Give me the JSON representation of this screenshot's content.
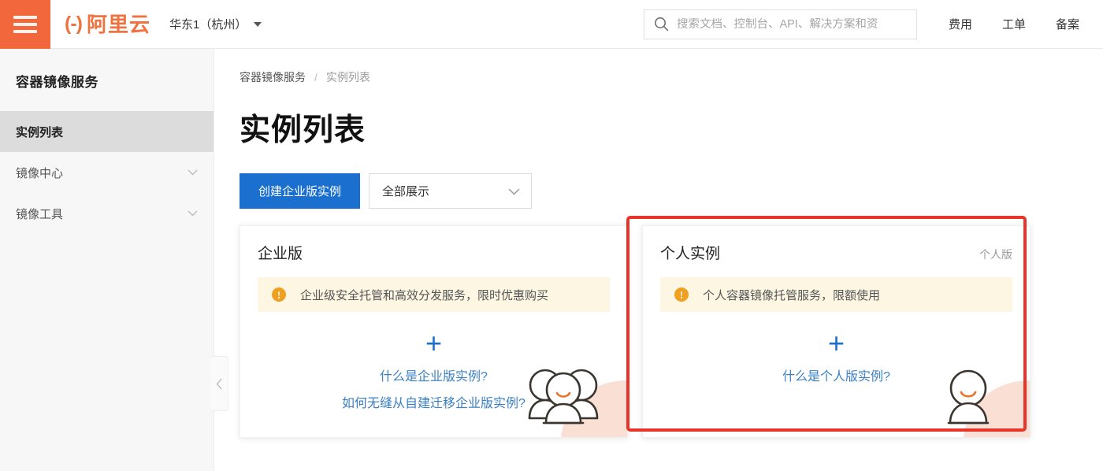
{
  "header": {
    "menu_icon": "hamburger-icon",
    "logo_mark": "(-)",
    "logo_text": "阿里云",
    "region": "华东1（杭州）",
    "search": {
      "icon": "search-icon",
      "value": "",
      "placeholder": "搜索文档、控制台、API、解决方案和资"
    },
    "links": [
      {
        "label": "费用"
      },
      {
        "label": "工单"
      },
      {
        "label": "备案"
      }
    ]
  },
  "sidebar": {
    "title": "容器镜像服务",
    "items": [
      {
        "label": "实例列表",
        "active": true,
        "expandable": false
      },
      {
        "label": "镜像中心",
        "active": false,
        "expandable": true
      },
      {
        "label": "镜像工具",
        "active": false,
        "expandable": true
      }
    ],
    "collapse_icon": "chevron-left-icon"
  },
  "main": {
    "breadcrumb": {
      "root": "容器镜像服务",
      "separator": "/",
      "current": "实例列表"
    },
    "page_title": "实例列表",
    "toolbar": {
      "create_button": "创建企业版实例",
      "filter_value": "全部展示"
    },
    "cards": [
      {
        "title": "企业版",
        "badge": "",
        "notice": "企业级安全托管和高效分发服务，限时优惠购买",
        "plus": "+",
        "links": [
          "什么是企业版实例?",
          "如何无缝从自建迁移企业版实例?"
        ],
        "illustration": "group-people-icon",
        "highlighted": false
      },
      {
        "title": "个人实例",
        "badge": "个人版",
        "notice": "个人容器镜像托管服务，限额使用",
        "plus": "+",
        "links": [
          "什么是个人版实例?"
        ],
        "illustration": "single-person-icon",
        "highlighted": true
      }
    ]
  },
  "colors": {
    "brand_orange": "#f2683c",
    "primary_blue": "#1b6fce",
    "link_blue": "#3a7fc4",
    "notice_bg": "#fdf6e3",
    "warn_orange": "#f0a020",
    "annotation_red": "#e83429",
    "sidebar_bg": "#f7f7f7",
    "sidebar_active_bg": "#dcdcdc"
  }
}
